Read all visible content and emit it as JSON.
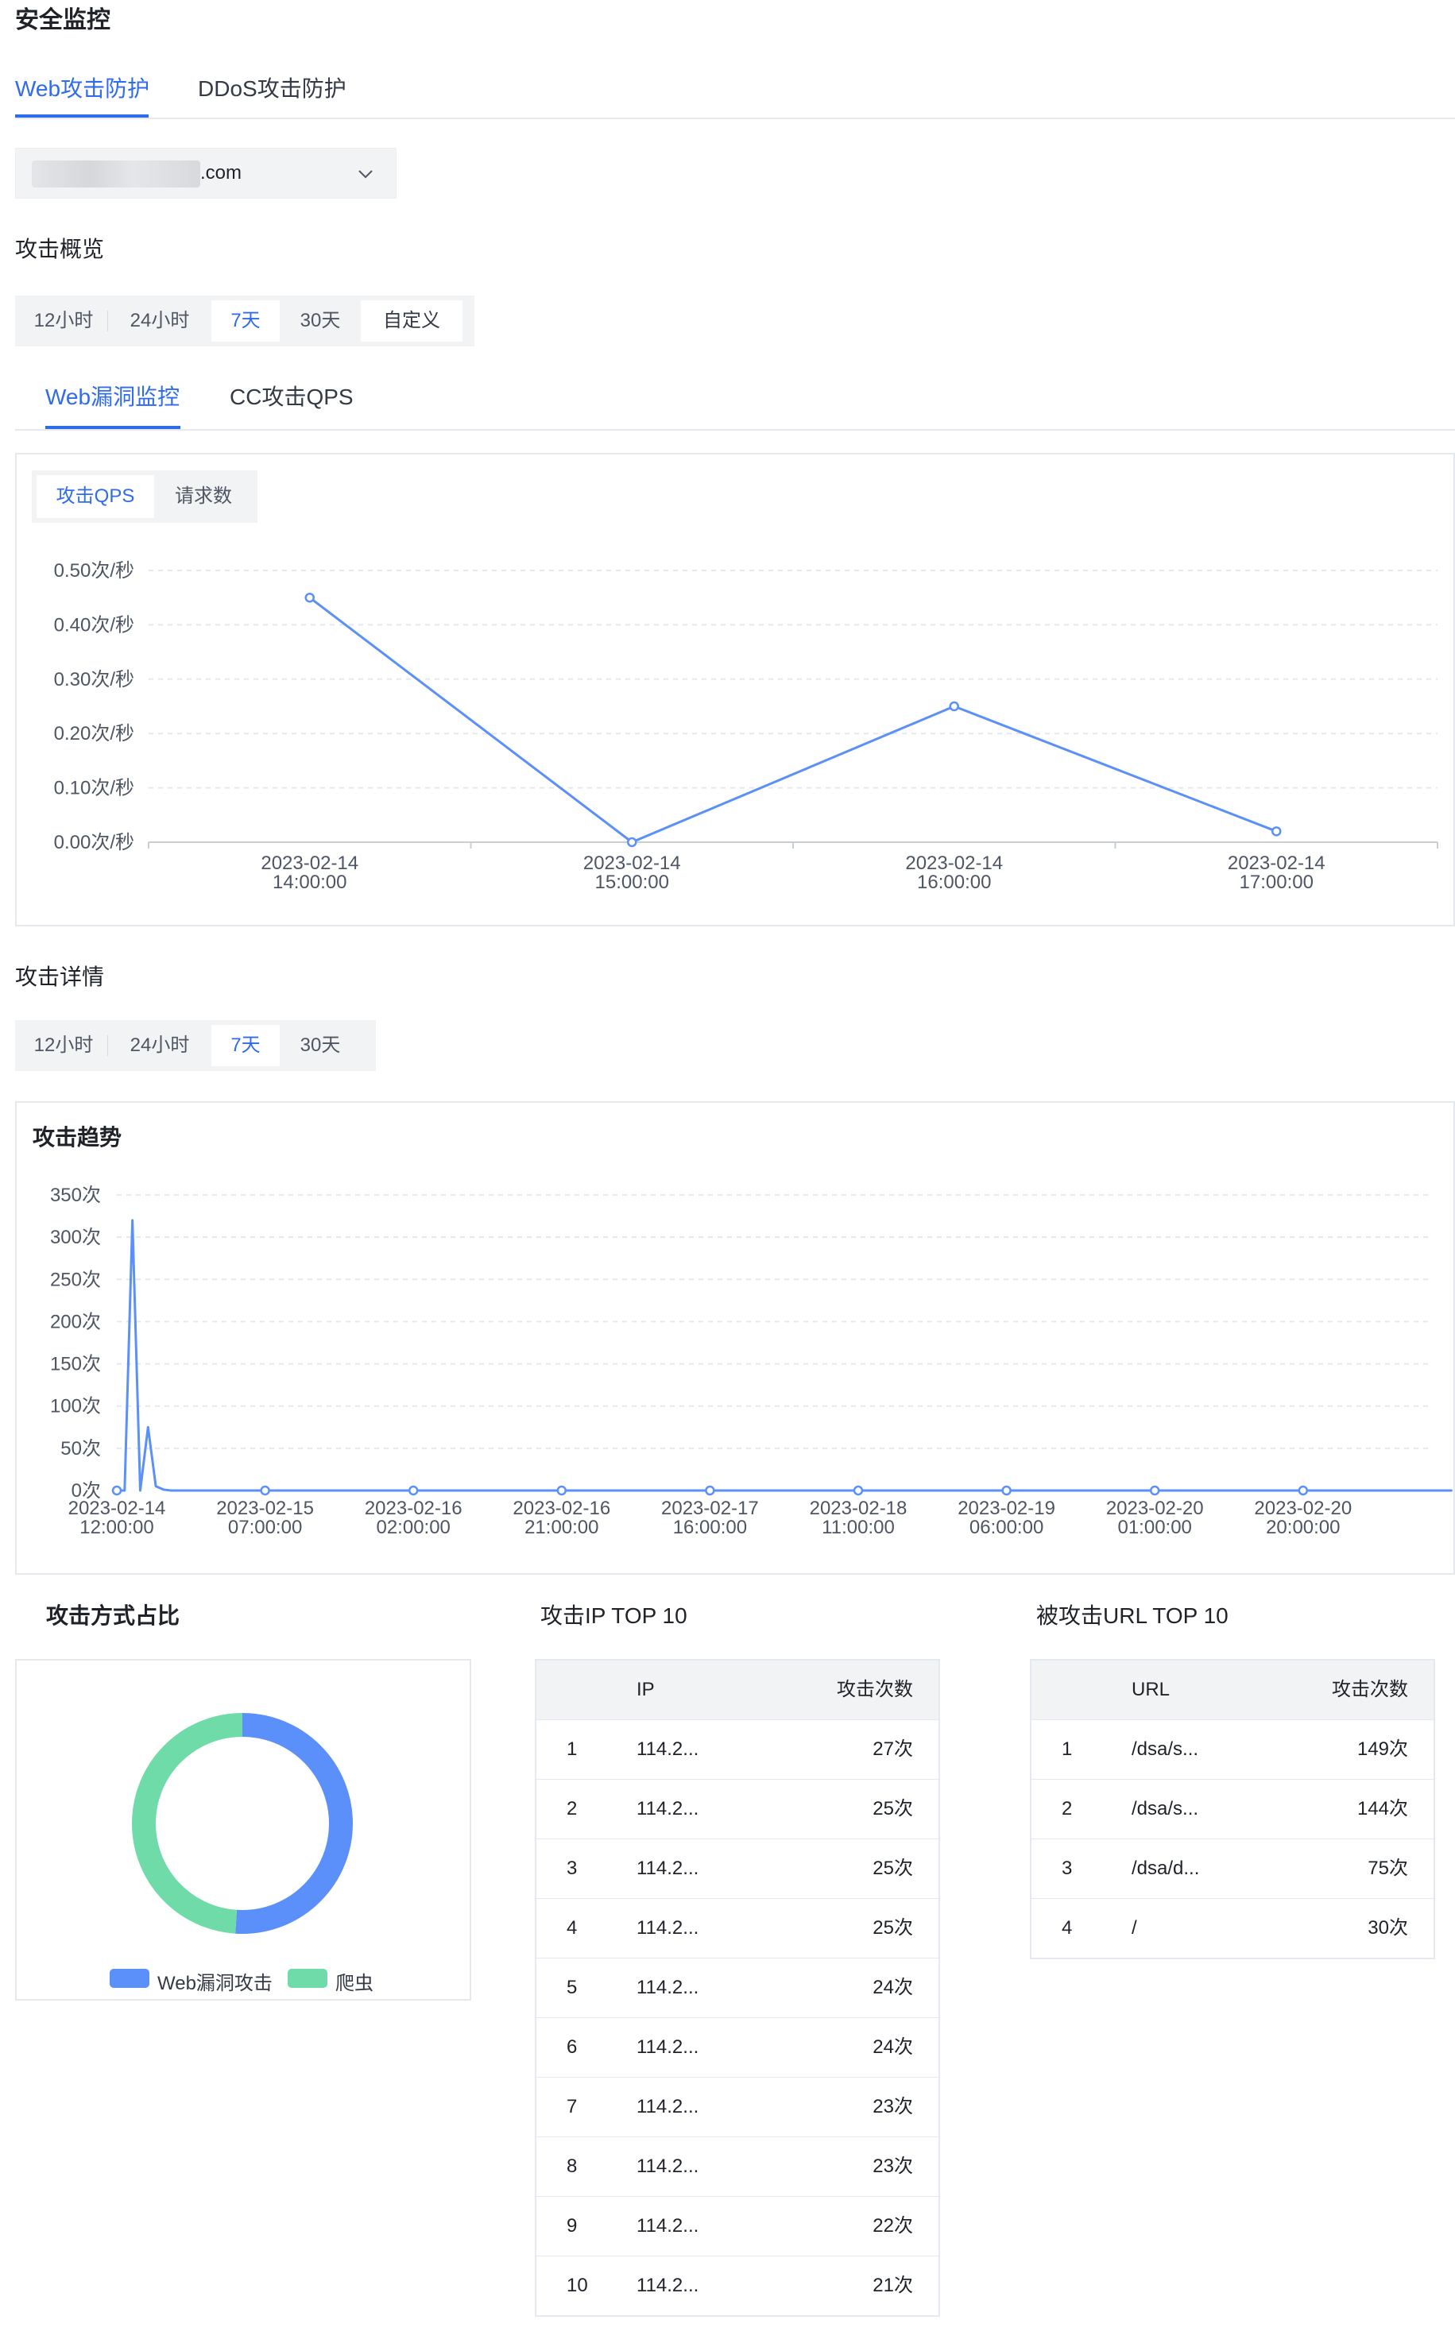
{
  "page": {
    "title": "安全监控"
  },
  "top_tabs": [
    {
      "label": "Web攻击防护",
      "active": true
    },
    {
      "label": "DDoS攻击防护",
      "active": false
    }
  ],
  "domain_select": {
    "suffix": ".com"
  },
  "overview": {
    "title": "攻击概览",
    "time_options": [
      {
        "label": "12小时",
        "active": false
      },
      {
        "label": "24小时",
        "active": false
      },
      {
        "label": "7天",
        "active": true
      },
      {
        "label": "30天",
        "active": false
      },
      {
        "label": "自定义",
        "active": false
      }
    ],
    "sub_tabs": [
      {
        "label": "Web漏洞监控",
        "active": true
      },
      {
        "label": "CC攻击QPS",
        "active": false
      }
    ],
    "metric_toggle": [
      {
        "label": "攻击QPS",
        "active": true
      },
      {
        "label": "请求数",
        "active": false
      }
    ]
  },
  "details": {
    "title": "攻击详情",
    "time_options": [
      {
        "label": "12小时",
        "active": false
      },
      {
        "label": "24小时",
        "active": false
      },
      {
        "label": "7天",
        "active": true
      },
      {
        "label": "30天",
        "active": false
      }
    ],
    "trend_title": "攻击趋势",
    "pie_title": "攻击方式占比",
    "ip_table": {
      "title": "攻击IP TOP 10",
      "headers": [
        "IP",
        "攻击次数"
      ],
      "rows": [
        [
          "1",
          "114.2...",
          "27次"
        ],
        [
          "2",
          "114.2...",
          "25次"
        ],
        [
          "3",
          "114.2...",
          "25次"
        ],
        [
          "4",
          "114.2...",
          "25次"
        ],
        [
          "5",
          "114.2...",
          "24次"
        ],
        [
          "6",
          "114.2...",
          "24次"
        ],
        [
          "7",
          "114.2...",
          "23次"
        ],
        [
          "8",
          "114.2...",
          "23次"
        ],
        [
          "9",
          "114.2...",
          "22次"
        ],
        [
          "10",
          "114.2...",
          "21次"
        ]
      ]
    },
    "url_table": {
      "title": "被攻击URL TOP 10",
      "headers": [
        "URL",
        "攻击次数"
      ],
      "rows": [
        [
          "1",
          "/dsa/s...",
          "149次"
        ],
        [
          "2",
          "/dsa/s...",
          "144次"
        ],
        [
          "3",
          "/dsa/d...",
          "75次"
        ],
        [
          "4",
          "/",
          "30次"
        ]
      ]
    }
  },
  "colors": {
    "accent": "#2f6bed",
    "line": "#5b8ff9",
    "green": "#6fdba8"
  },
  "chart_data": [
    {
      "type": "line",
      "x": [
        "2023-02-14 14:00:00",
        "2023-02-14 15:00:00",
        "2023-02-14 16:00:00",
        "2023-02-14 17:00:00"
      ],
      "series": [
        {
          "values": [
            0.45,
            0.0,
            0.25,
            0.02
          ]
        }
      ],
      "y_ticks": [
        "0.00次/秒",
        "0.10次/秒",
        "0.20次/秒",
        "0.30次/秒",
        "0.40次/秒",
        "0.50次/秒"
      ],
      "ylim": [
        0,
        0.5
      ],
      "grid": true
    },
    {
      "type": "line",
      "x_tick_labels": [
        "2023-02-14 12:00:00",
        "2023-02-15 07:00:00",
        "2023-02-16 02:00:00",
        "2023-02-16 21:00:00",
        "2023-02-17 16:00:00",
        "2023-02-18 11:00:00",
        "2023-02-19 06:00:00",
        "2023-02-20 01:00:00",
        "2023-02-20 20:00:00"
      ],
      "y_ticks": [
        "0次",
        "50次",
        "100次",
        "150次",
        "200次",
        "250次",
        "300次",
        "350次"
      ],
      "ylim": [
        0,
        350
      ],
      "grid": true,
      "series": [
        {
          "hours": [
            0,
            1,
            2,
            3,
            4,
            5,
            6,
            7,
            8,
            19,
            38,
            57,
            76,
            95,
            114,
            133,
            152,
            171,
            175
          ],
          "values": [
            0,
            0,
            320,
            0,
            75,
            5,
            1,
            0,
            0,
            0,
            0,
            0,
            0,
            0,
            0,
            0,
            0,
            0,
            0
          ],
          "marked_hours": [
            0,
            19,
            38,
            57,
            76,
            95,
            114,
            133,
            152
          ]
        }
      ]
    },
    {
      "type": "pie",
      "categories": [
        "Web漏洞攻击",
        "爬虫"
      ],
      "values": [
        51,
        49
      ],
      "colors": [
        "#5b8ff9",
        "#6fdba8"
      ]
    }
  ]
}
